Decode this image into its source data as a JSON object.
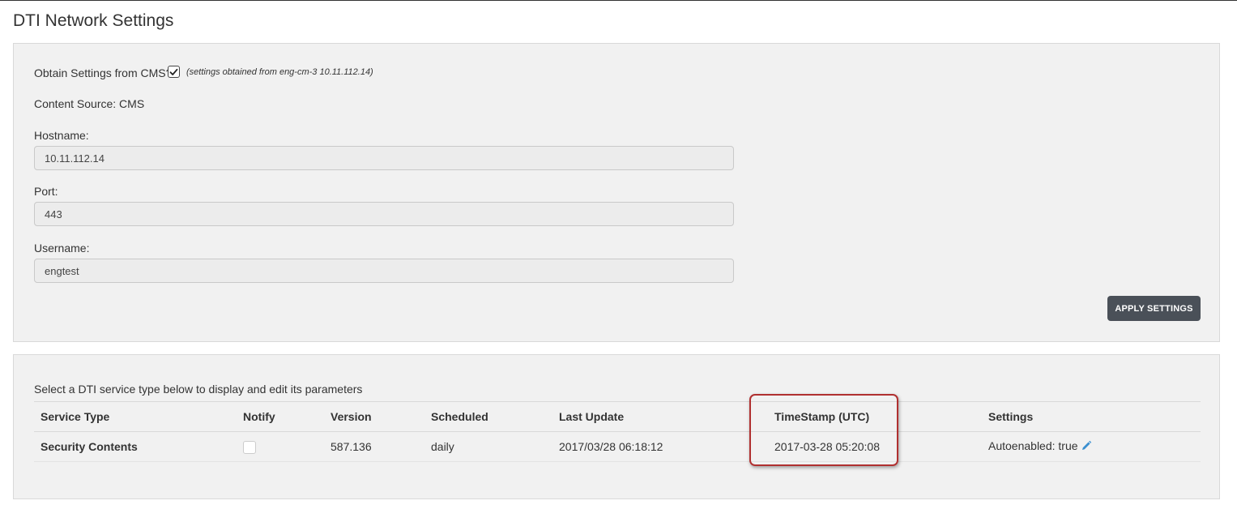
{
  "page": {
    "title": "DTI Network Settings"
  },
  "settings": {
    "obtain_label": "Obtain Settings from CMS?",
    "obtain_checked": true,
    "obtain_note": "(settings obtained from eng-cm-3 10.11.112.14)",
    "content_source": "Content Source: CMS",
    "hostname_label": "Hostname:",
    "hostname_value": "10.11.112.14",
    "port_label": "Port:",
    "port_value": "443",
    "username_label": "Username:",
    "username_value": "engtest",
    "apply_label": "APPLY SETTINGS"
  },
  "services": {
    "intro": "Select a DTI service type below to display and edit its parameters",
    "columns": [
      "Service Type",
      "Notify",
      "Version",
      "Scheduled",
      "Last Update",
      "TimeStamp (UTC)",
      "Settings"
    ],
    "rows": [
      {
        "service_type": "Security Contents",
        "notify": false,
        "version": "587.136",
        "scheduled": "daily",
        "last_update": "2017/03/28 06:18:12",
        "timestamp": "2017-03-28 05:20:08",
        "settings": "Autoenabled: true"
      }
    ]
  },
  "colors": {
    "button": "#4a5058",
    "highlight": "#b03030",
    "edit_icon": "#3a8fd0"
  },
  "icons": {
    "checkbox": "checkmark-icon",
    "edit": "pencil-icon"
  }
}
